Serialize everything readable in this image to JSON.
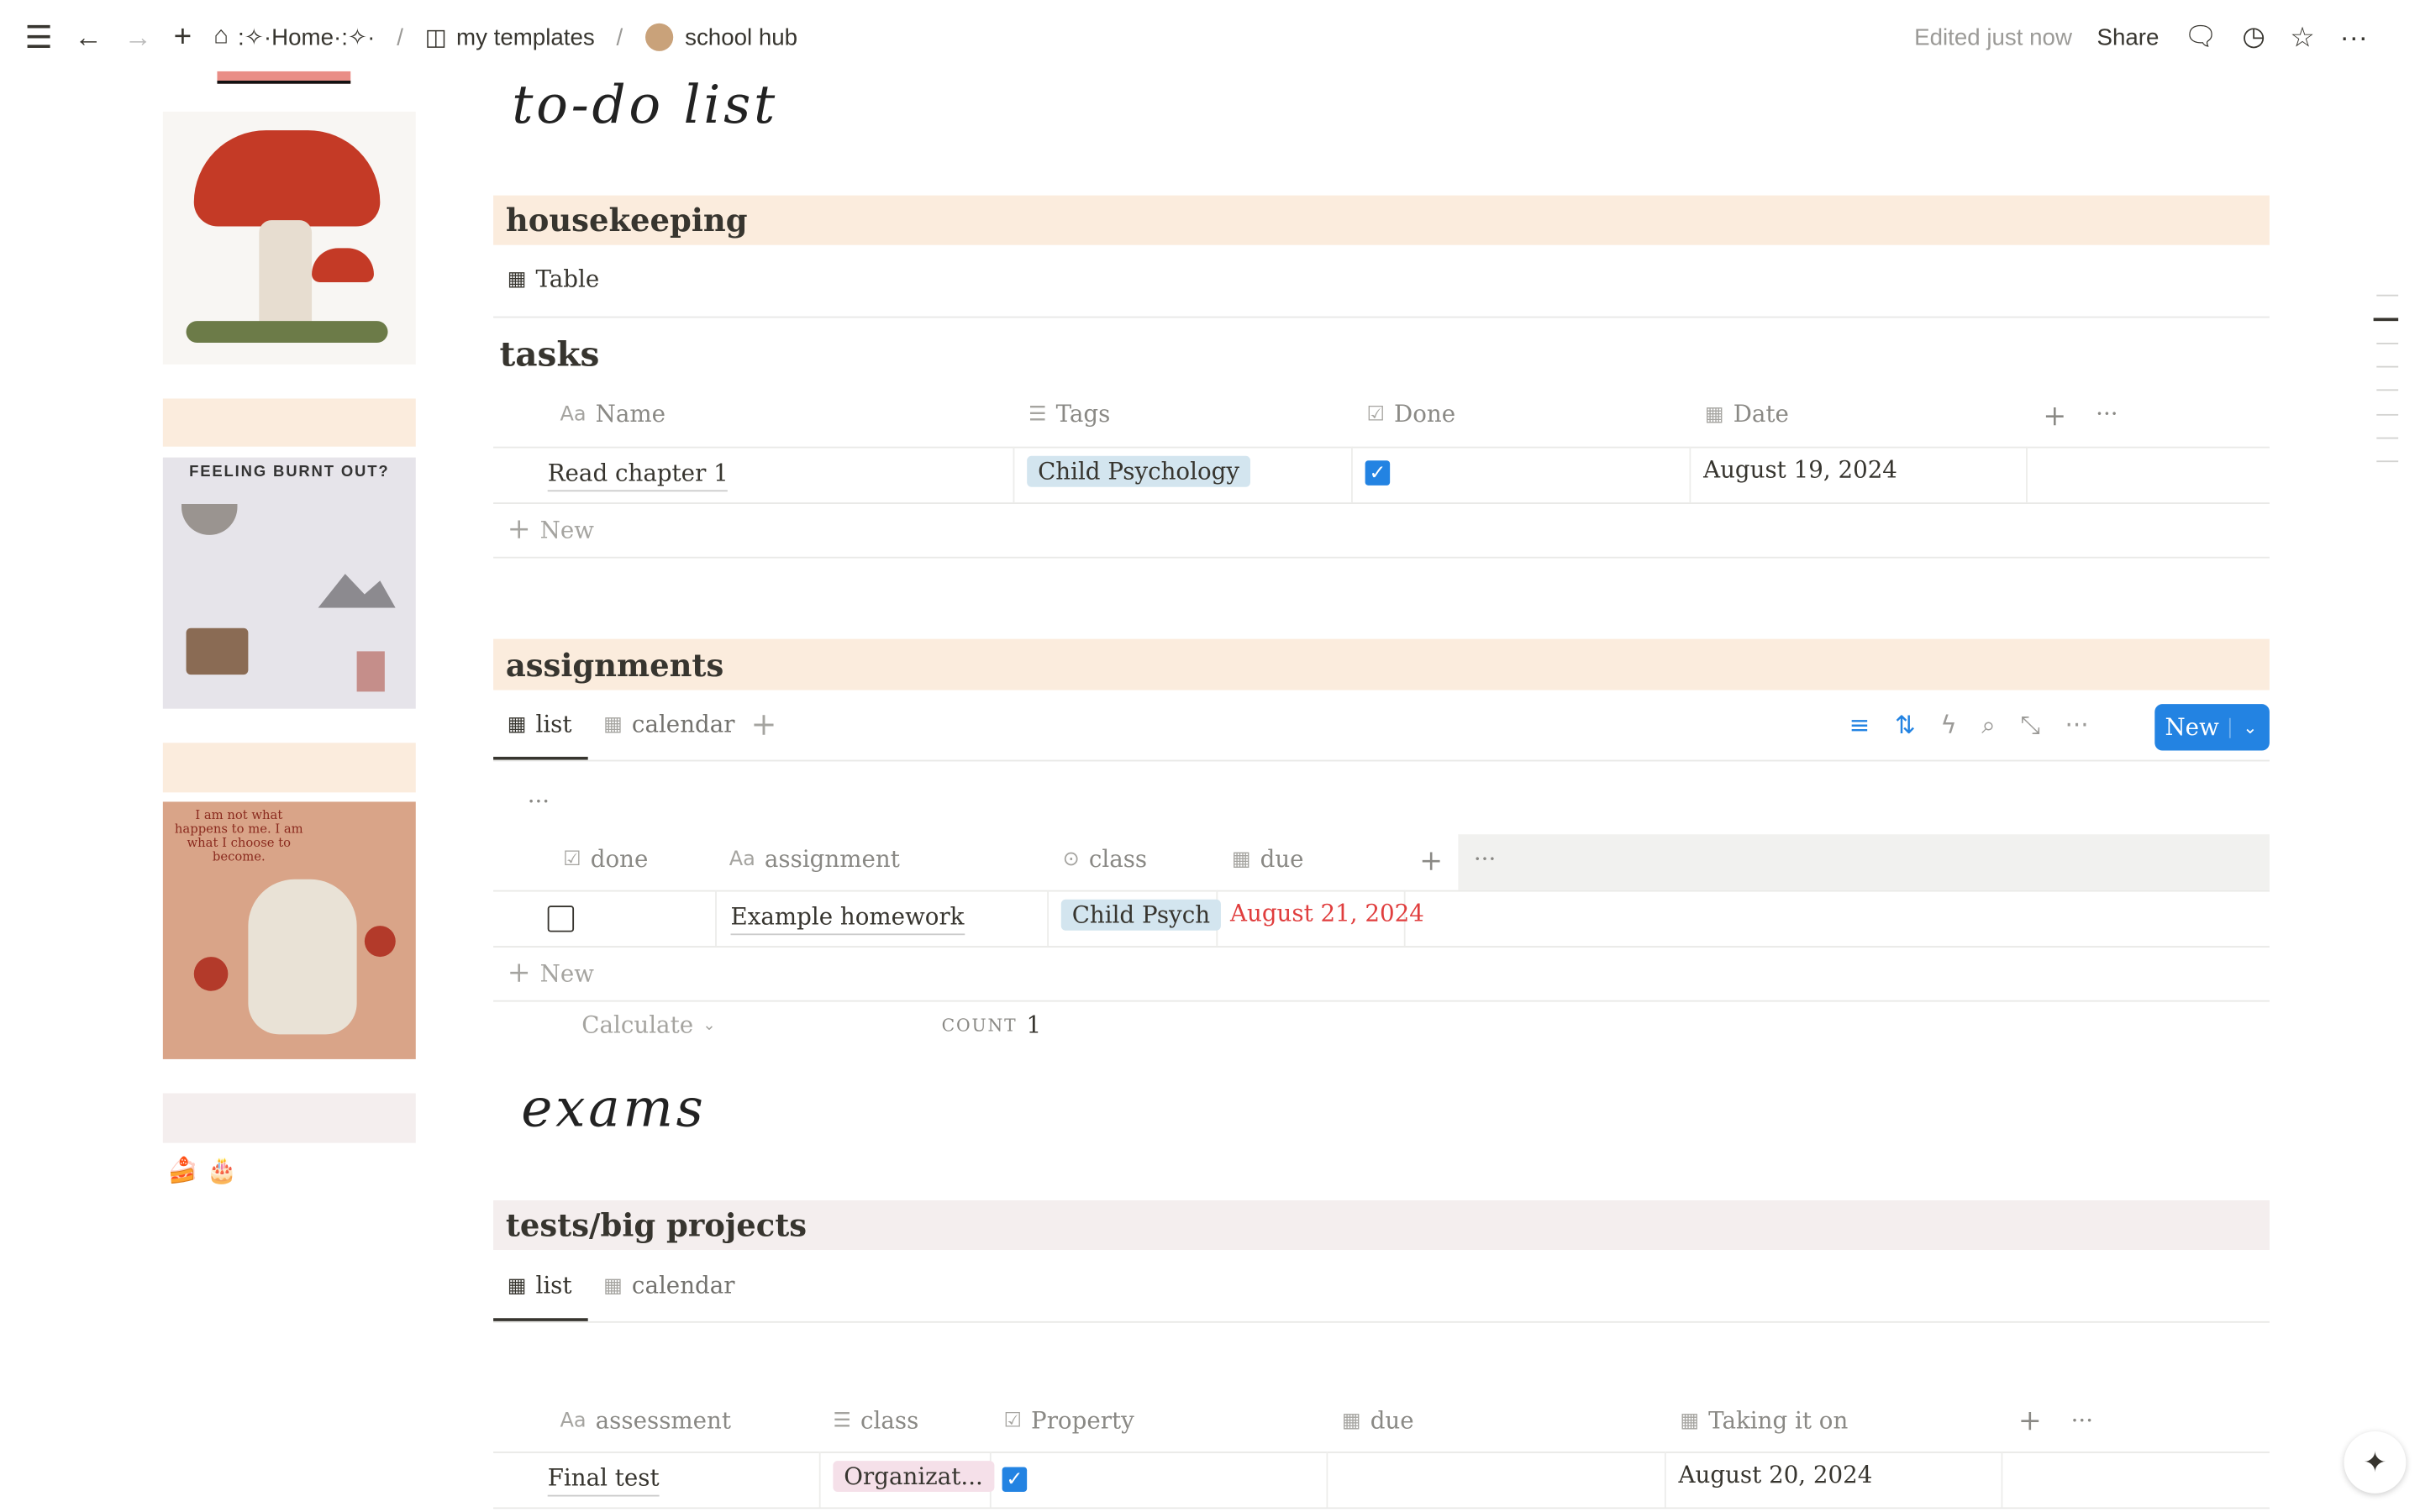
{
  "topbar": {
    "home": ":✧·Home·:✧·",
    "crumb1": "my templates",
    "crumb2": "school hub",
    "separator": "/",
    "edited": "Edited just now",
    "share": "Share"
  },
  "sidebar": {
    "burnout_text": "FEELING BURNT OUT?",
    "cat_quote": "I am not what happens to me. I am what I choose to become.",
    "emoji": "🍰 🎂"
  },
  "todo_title": "to-do list",
  "housekeeping": {
    "title": "housekeeping",
    "view": "Table"
  },
  "tasks": {
    "title": "tasks",
    "columns": [
      "Name",
      "Tags",
      "Done",
      "Date"
    ],
    "rows": [
      {
        "name": "Read chapter 1",
        "tag": "Child Psychology",
        "done": true,
        "date": "August 19, 2024"
      }
    ],
    "new": "New"
  },
  "assignments": {
    "title": "assignments",
    "tabs": [
      "list",
      "calendar"
    ],
    "new_button": "New",
    "columns": [
      "done",
      "assignment",
      "class",
      "due"
    ],
    "rows": [
      {
        "done": false,
        "assignment": "Example homework",
        "class": "Child Psych",
        "due": "August 21, 2024"
      }
    ],
    "new": "New",
    "calculate": "Calculate",
    "count_label": "COUNT",
    "count": "1",
    "due_color": "#e03e3e"
  },
  "exams_title": "exams",
  "tests": {
    "title": "tests/big projects",
    "tabs": [
      "list",
      "calendar"
    ],
    "columns": [
      "assessment",
      "class",
      "Property",
      "due",
      "Taking it on"
    ],
    "rows": [
      {
        "assessment": "Final test",
        "class": "Organizat...",
        "property": true,
        "due": "",
        "taking": "August 20, 2024"
      }
    ]
  },
  "colors": {
    "accent": "#2383e2",
    "band": "#fbecdd",
    "band_pink": "#f4eeee",
    "tag_blue": "#d3e5ef",
    "tag_pink": "#f5e0e9"
  }
}
